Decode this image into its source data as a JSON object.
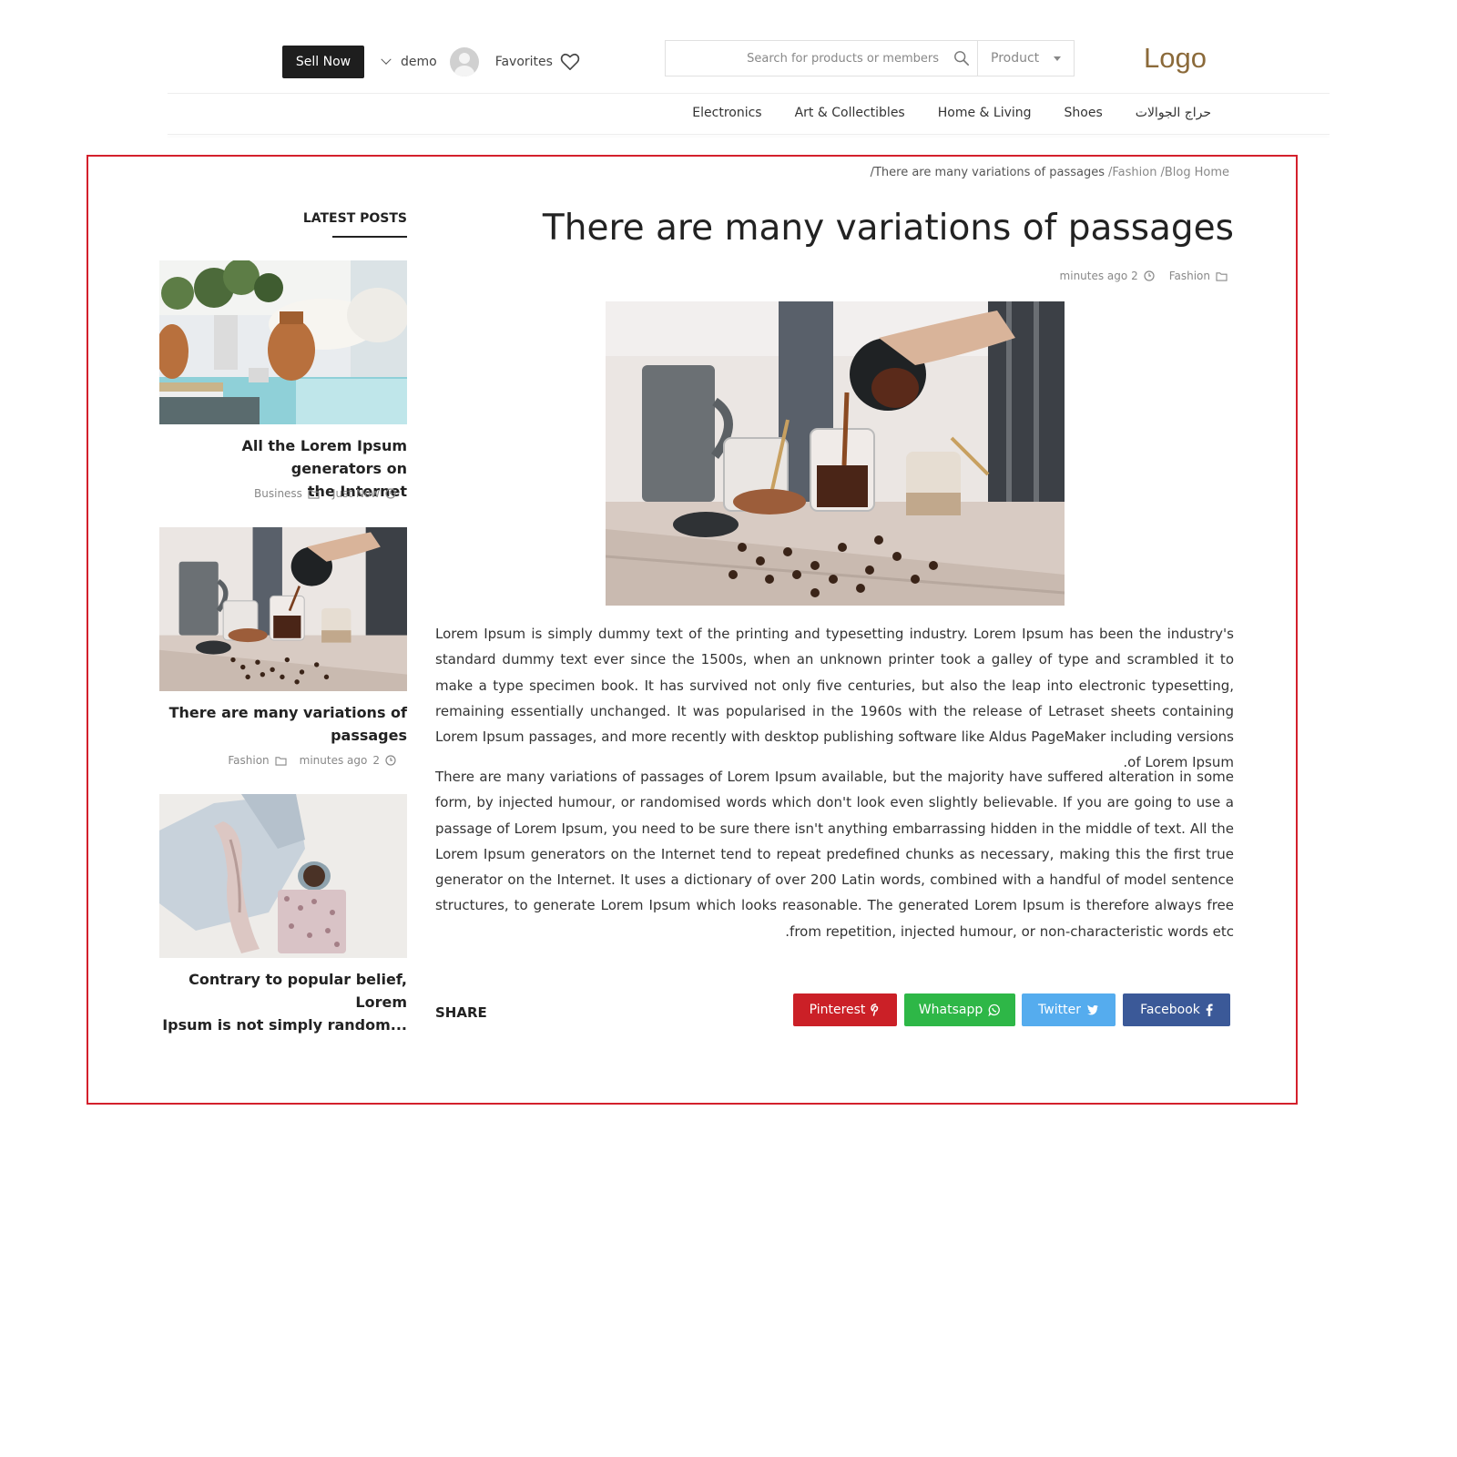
{
  "header": {
    "sell_now": "Sell Now",
    "user_name": "demo",
    "favorites": "Favorites",
    "search_placeholder": "Search for products or members",
    "product_select": "Product",
    "logo": "Logo"
  },
  "nav": {
    "items": [
      "Electronics",
      "Art & Collectibles",
      "Home & Living",
      "Shoes",
      "حراج الجوالات"
    ]
  },
  "breadcrumb": {
    "current": "There are many variations of passages/",
    "fashion": "Fashion/",
    "blog": "Blog/",
    "home": "Home"
  },
  "sidebar": {
    "title": "LATEST POSTS",
    "posts": [
      {
        "title_line1": "All the Lorem Ipsum generators on",
        "title_line2": "the Internet",
        "category": "Business",
        "time": "Just Now"
      },
      {
        "title_line1": "There are many variations of",
        "title_line2": "passages",
        "category": "Fashion",
        "time": "minutes ago",
        "time_num": "2"
      },
      {
        "title_line1": "Contrary to popular belief, Lorem",
        "title_line2": "Ipsum is not simply random..."
      }
    ]
  },
  "article": {
    "title": "There are many variations of passages",
    "time": "minutes ago 2",
    "category": "Fashion",
    "paragraph1": "Lorem Ipsum is simply dummy text of the printing and typesetting industry. Lorem Ipsum has been the industry's standard dummy text ever since the 1500s, when an unknown printer took a galley of type and scrambled it to make a type specimen book. It has survived not only five centuries, but also the leap into electronic typesetting, remaining essentially unchanged. It was popularised in the 1960s with the release of Letraset sheets containing Lorem Ipsum passages, and more recently with desktop publishing software like Aldus PageMaker including versions of Lorem Ipsum.",
    "paragraph2": "There are many variations of passages of Lorem Ipsum available, but the majority have suffered alteration in some form, by injected humour, or randomised words which don't look even slightly believable. If you are going to use a passage of Lorem Ipsum, you need to be sure there isn't anything embarrassing hidden in the middle of text. All the Lorem Ipsum generators on the Internet tend to repeat predefined chunks as necessary, making this the first true generator on the Internet. It uses a dictionary of over 200 Latin words, combined with a handful of model sentence structures, to generate Lorem Ipsum which looks reasonable. The generated Lorem Ipsum is therefore always free from repetition, injected humour, or non-characteristic words etc."
  },
  "share": {
    "label": "SHARE",
    "pinterest": "Pinterest",
    "whatsapp": "Whatsapp",
    "twitter": "Twitter",
    "facebook": "Facebook"
  },
  "colors": {
    "frame_border": "#d4202c",
    "logo": "#8b6a3a",
    "pinterest": "#cb2027",
    "whatsapp": "#2eb747",
    "twitter": "#55acee",
    "facebook": "#3b5998"
  }
}
